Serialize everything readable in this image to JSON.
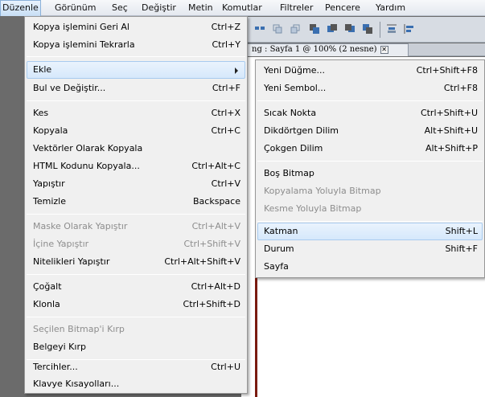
{
  "menubar": {
    "items": [
      "Düzenle",
      "Görünüm",
      "Seç",
      "Değiştir",
      "Metin",
      "Komutlar",
      "Filtreler",
      "Pencere",
      "Yardım"
    ]
  },
  "document": {
    "tab_title": "ng : Sayfa 1 @ 100% (2 nesne)",
    "close_glyph": "✕"
  },
  "edit_menu": {
    "items": [
      {
        "label": "Kopya işlemini Geri Al",
        "shortcut": "Ctrl+Z"
      },
      {
        "label": "Kopya işlemini Tekrarla",
        "shortcut": "Ctrl+Y"
      },
      {
        "label": "Ekle",
        "shortcut": ""
      },
      {
        "label": "Bul ve Değiştir...",
        "shortcut": "Ctrl+F"
      },
      {
        "label": "Kes",
        "shortcut": "Ctrl+X"
      },
      {
        "label": "Kopyala",
        "shortcut": "Ctrl+C"
      },
      {
        "label": "Vektörler Olarak Kopyala",
        "shortcut": ""
      },
      {
        "label": "HTML Kodunu Kopyala...",
        "shortcut": "Ctrl+Alt+C"
      },
      {
        "label": "Yapıştır",
        "shortcut": "Ctrl+V"
      },
      {
        "label": "Temizle",
        "shortcut": "Backspace"
      },
      {
        "label": "Maske Olarak Yapıştır",
        "shortcut": "Ctrl+Alt+V"
      },
      {
        "label": "İçine Yapıştır",
        "shortcut": "Ctrl+Shift+V"
      },
      {
        "label": "Nitelikleri Yapıştır",
        "shortcut": "Ctrl+Alt+Shift+V"
      },
      {
        "label": "Çoğalt",
        "shortcut": "Ctrl+Alt+D"
      },
      {
        "label": "Klonla",
        "shortcut": "Ctrl+Shift+D"
      },
      {
        "label": "Seçilen Bitmap'i Kırp",
        "shortcut": ""
      },
      {
        "label": "Belgeyi Kırp",
        "shortcut": ""
      },
      {
        "label": "Tercihler...",
        "shortcut": "Ctrl+U"
      },
      {
        "label": "Klavye Kısayolları...",
        "shortcut": ""
      }
    ]
  },
  "insert_submenu": {
    "items": [
      {
        "label": "Yeni Düğme...",
        "shortcut": "Ctrl+Shift+F8"
      },
      {
        "label": "Yeni Sembol...",
        "shortcut": "Ctrl+F8"
      },
      {
        "label": "Sıcak Nokta",
        "shortcut": "Ctrl+Shift+U"
      },
      {
        "label": "Dikdörtgen Dilim",
        "shortcut": "Alt+Shift+U"
      },
      {
        "label": "Çokgen Dilim",
        "shortcut": "Alt+Shift+P"
      },
      {
        "label": "Boş Bitmap",
        "shortcut": ""
      },
      {
        "label": "Kopyalama Yoluyla Bitmap",
        "shortcut": ""
      },
      {
        "label": "Kesme Yoluyla Bitmap",
        "shortcut": ""
      },
      {
        "label": "Katman",
        "shortcut": "Shift+L"
      },
      {
        "label": "Durum",
        "shortcut": "Shift+F"
      },
      {
        "label": "Sayfa",
        "shortcut": ""
      }
    ]
  },
  "colors": {
    "menu_bg": "#f0f0f0",
    "highlight": "#d6e8fb",
    "disabled_text": "#8d8d8d"
  }
}
